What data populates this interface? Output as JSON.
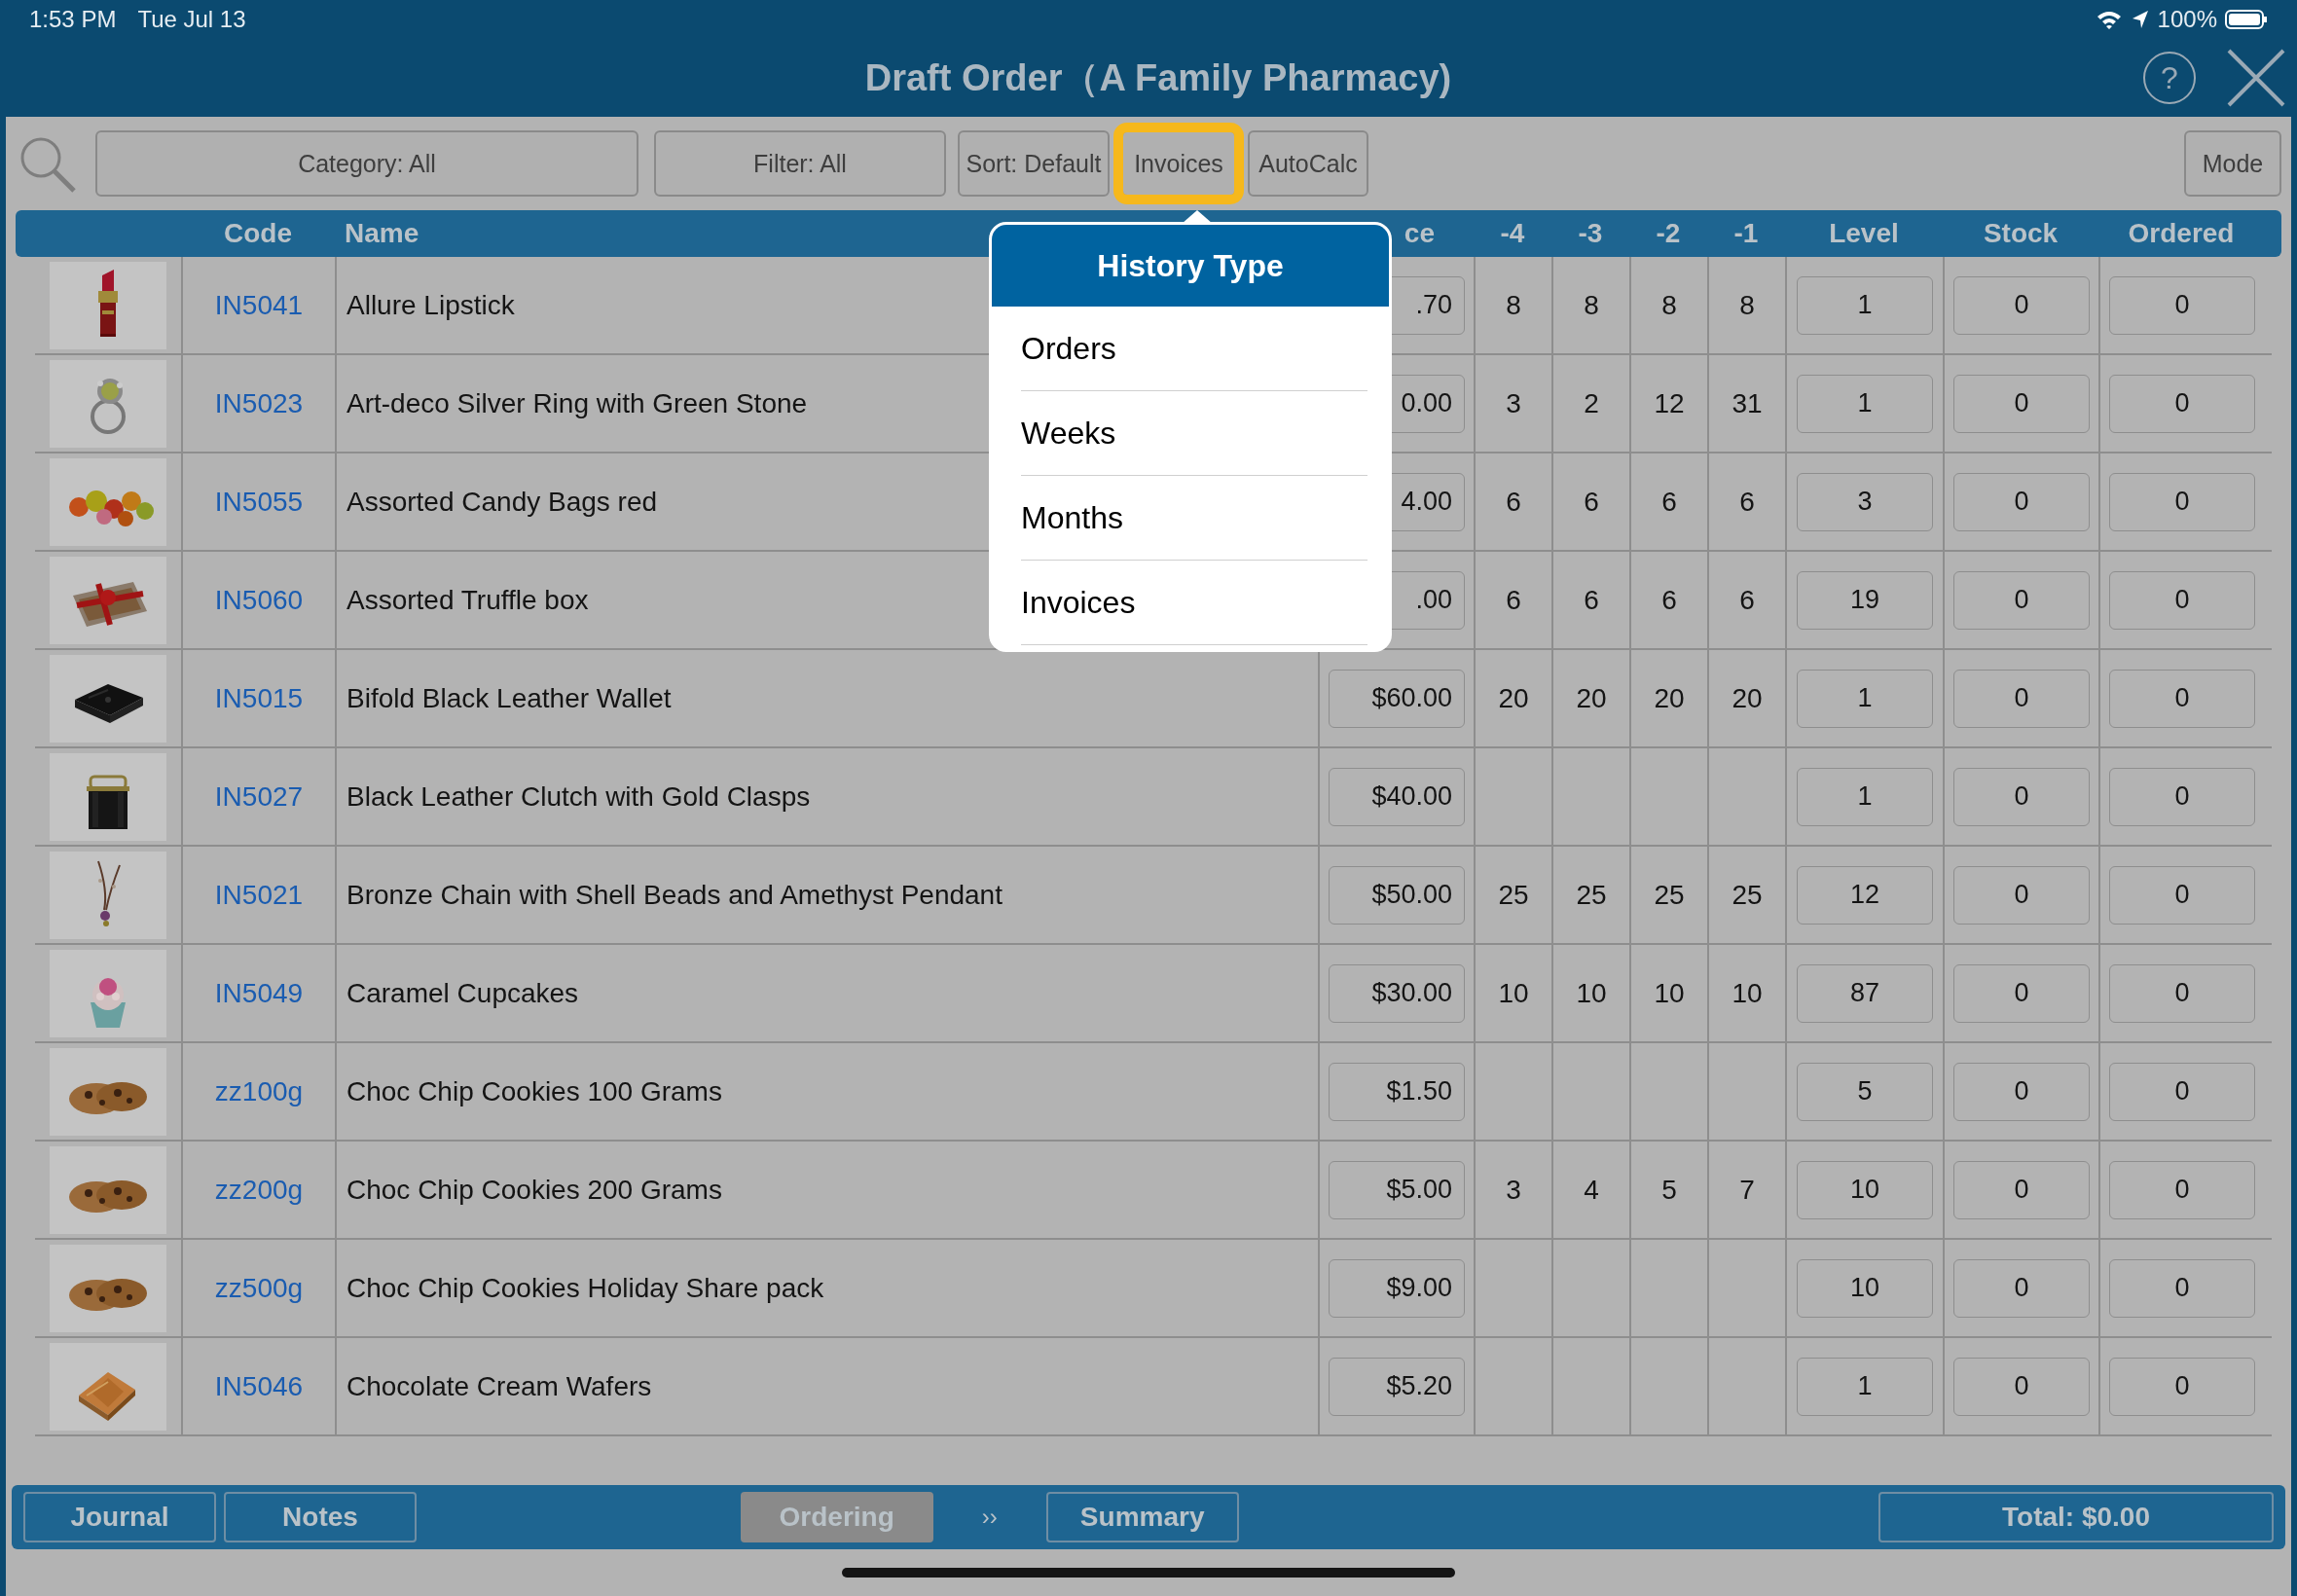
{
  "status_bar": {
    "time": "1:53 PM",
    "date": "Tue Jul 13",
    "battery": "100%"
  },
  "window": {
    "title": "Draft Order（A Family Pharmacy)",
    "help": "?"
  },
  "toolbar": {
    "buttons": [
      {
        "label": "Category: All",
        "highlighted": false
      },
      {
        "label": "Filter: All",
        "highlighted": false
      },
      {
        "label": "Sort: Default",
        "highlighted": false
      },
      {
        "label": "Invoices",
        "highlighted": true
      },
      {
        "label": "AutoCalc",
        "highlighted": false
      }
    ],
    "mode": "Mode"
  },
  "table": {
    "columns": [
      "Code",
      "Name",
      "ce",
      "-4",
      "-3",
      "-2",
      "-1",
      "Level",
      "Stock",
      "Ordered"
    ],
    "rows": [
      {
        "code": "IN5041",
        "name": "Allure Lipstick",
        "price": ".70",
        "history": [
          "8",
          "8",
          "8",
          "8"
        ],
        "level": "1",
        "stock": "0",
        "ordered": "0"
      },
      {
        "code": "IN5023",
        "name": "Art-deco Silver Ring with Green Stone",
        "price": "0.00",
        "history": [
          "3",
          "2",
          "12",
          "31"
        ],
        "level": "1",
        "stock": "0",
        "ordered": "0"
      },
      {
        "code": "IN5055",
        "name": "Assorted Candy Bags red",
        "price": "4.00",
        "history": [
          "6",
          "6",
          "6",
          "6"
        ],
        "level": "3",
        "stock": "0",
        "ordered": "0"
      },
      {
        "code": "IN5060",
        "name": "Assorted Truffle box",
        "price": ".00",
        "history": [
          "6",
          "6",
          "6",
          "6"
        ],
        "level": "19",
        "stock": "0",
        "ordered": "0"
      },
      {
        "code": "IN5015",
        "name": "Bifold Black Leather Wallet",
        "price": "$60.00",
        "history": [
          "20",
          "20",
          "20",
          "20"
        ],
        "level": "1",
        "stock": "0",
        "ordered": "0"
      },
      {
        "code": "IN5027",
        "name": "Black Leather Clutch with Gold Clasps",
        "price": "$40.00",
        "level": "1",
        "stock": "0",
        "ordered": "0"
      },
      {
        "code": "IN5021",
        "name": "Bronze Chain with Shell Beads and Amethyst Pendant",
        "price": "$50.00",
        "history": [
          "25",
          "25",
          "25",
          "25"
        ],
        "level": "12",
        "stock": "0",
        "ordered": "0"
      },
      {
        "code": "IN5049",
        "name": "Caramel Cupcakes",
        "price": "$30.00",
        "history": [
          "10",
          "10",
          "10",
          "10"
        ],
        "level": "87",
        "stock": "0",
        "ordered": "0"
      },
      {
        "code": "zz100g",
        "name": "Choc Chip Cookies 100 Grams",
        "price": "$1.50",
        "level": "5",
        "stock": "0",
        "ordered": "0"
      },
      {
        "code": "zz200g",
        "name": "Choc Chip Cookies 200 Grams",
        "price": "$5.00",
        "history": [
          "3",
          "4",
          "5",
          "7"
        ],
        "level": "10",
        "stock": "0",
        "ordered": "0"
      },
      {
        "code": "zz500g",
        "name": "Choc Chip Cookies Holiday Share pack",
        "price": "$9.00",
        "level": "10",
        "stock": "0",
        "ordered": "0"
      },
      {
        "code": "IN5046",
        "name": "Chocolate Cream Wafers",
        "price": "$5.20",
        "level": "1",
        "stock": "0",
        "ordered": "0"
      }
    ]
  },
  "popover": {
    "title": "History Type",
    "items": [
      "Orders",
      "Weeks",
      "Months",
      "Invoices"
    ]
  },
  "footer": {
    "left": [
      "Journal",
      "Notes"
    ],
    "steps": [
      {
        "label": "Ordering",
        "selected": true
      },
      {
        "label": "Summary",
        "selected": false
      }
    ],
    "separator": "››",
    "total": "Total: $0.00"
  }
}
